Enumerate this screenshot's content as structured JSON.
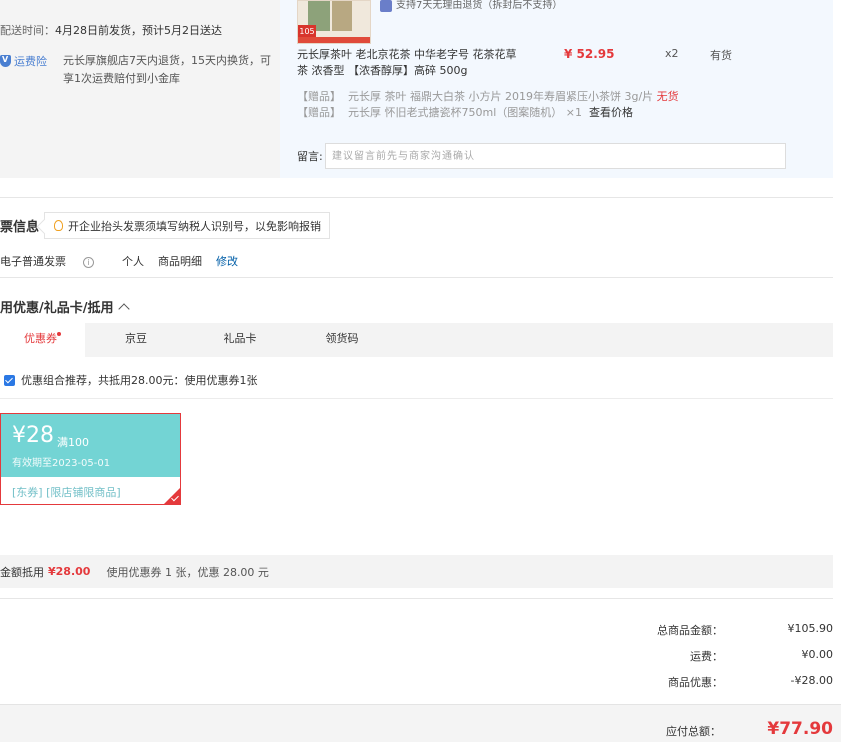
{
  "delivery": {
    "label": "配送时间：",
    "value": "4月28日前发货，预计5月2日送达"
  },
  "insurance": {
    "badge": "运费险",
    "desc": "元长厚旗舰店7天内退货，15天内换货，可享1次运费赔付到小金库"
  },
  "product": {
    "top_tag": "支持7天无理由退货（拆封后不支持）",
    "thumb_price": "105",
    "name": "元长厚茶叶 老北京花茶 中华老字号 花茶花草茶 浓香型 【浓香醇厚】高碎 500g",
    "price": "¥ 52.95",
    "qty": "x2",
    "stock": "有货",
    "gifts": [
      {
        "tag": "【赠品】",
        "text": "元长厚 茶叶 福鼎大白茶 小方片 2019年寿眉紧压小茶饼 3g/片",
        "status": "无货",
        "action": ""
      },
      {
        "tag": "【赠品】",
        "text": "元长厚 怀旧老式搪瓷杯750ml（图案随机） ×1",
        "status": "",
        "action": "查看价格"
      }
    ],
    "message_label": "留言:",
    "message_placeholder": "建议留言前先与商家沟通确认"
  },
  "invoice": {
    "title": "票信息",
    "tip": "开企业抬头发票须填写纳税人识别号，以免影响报销",
    "type": "电子普通发票",
    "info_icon": "i",
    "header": "个人",
    "content": "商品明细",
    "edit": "修改"
  },
  "coupons": {
    "title": "用优惠/礼品卡/抵用",
    "tabs": [
      "优惠券",
      "京豆",
      "礼品卡",
      "领货码"
    ],
    "combo_text": "优惠组合推荐，共抵用28.00元：使用优惠券1张",
    "coupon": {
      "amount": "¥28",
      "condition": "满100",
      "expiry": "有效期至2023-05-01",
      "tags": "[东券]  [限店铺限商品]"
    },
    "deduct_label": "金额抵用",
    "deduct_value": "¥28.00",
    "deduct_desc": "使用优惠券 1 张，优惠 28.00 元"
  },
  "summary": {
    "rows": [
      {
        "label": "总商品金额：",
        "value": "¥105.90"
      },
      {
        "label": "运费：",
        "value": "¥0.00"
      },
      {
        "label": "商品优惠：",
        "value": "-¥28.00"
      }
    ],
    "total_label": "应付总额：",
    "total_value": "¥77.90"
  },
  "colors": {
    "accent_red": "#e4393c",
    "link_blue": "#005ea7",
    "coupon_teal": "#73d4d4"
  }
}
